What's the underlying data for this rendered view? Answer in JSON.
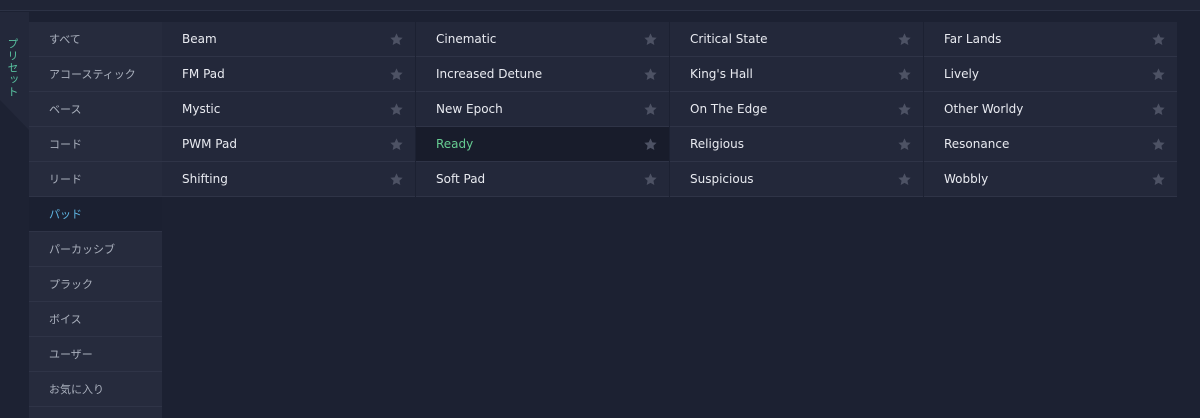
{
  "vertical_tab": {
    "label": "プリセット"
  },
  "sidebar": {
    "items": [
      {
        "label": "すべて",
        "active": false
      },
      {
        "label": "アコースティック",
        "active": false
      },
      {
        "label": "ベース",
        "active": false
      },
      {
        "label": "コード",
        "active": false
      },
      {
        "label": "リード",
        "active": false
      },
      {
        "label": "パッド",
        "active": true
      },
      {
        "label": "パーカッシブ",
        "active": false
      },
      {
        "label": "プラック",
        "active": false
      },
      {
        "label": "ボイス",
        "active": false
      },
      {
        "label": "ユーザー",
        "active": false
      },
      {
        "label": "お気に入り",
        "active": false
      }
    ]
  },
  "presets": [
    {
      "name": "Beam",
      "selected": false
    },
    {
      "name": "Cinematic",
      "selected": false
    },
    {
      "name": "Critical State",
      "selected": false
    },
    {
      "name": "Far Lands",
      "selected": false
    },
    {
      "name": "FM Pad",
      "selected": false
    },
    {
      "name": "Increased Detune",
      "selected": false
    },
    {
      "name": "King's Hall",
      "selected": false
    },
    {
      "name": "Lively",
      "selected": false
    },
    {
      "name": "Mystic",
      "selected": false
    },
    {
      "name": "New Epoch",
      "selected": false
    },
    {
      "name": "On The Edge",
      "selected": false
    },
    {
      "name": "Other Worldy",
      "selected": false
    },
    {
      "name": "PWM Pad",
      "selected": false
    },
    {
      "name": "Ready",
      "selected": true
    },
    {
      "name": "Religious",
      "selected": false
    },
    {
      "name": "Resonance",
      "selected": false
    },
    {
      "name": "Shifting",
      "selected": false
    },
    {
      "name": "Soft Pad",
      "selected": false
    },
    {
      "name": "Suspicious",
      "selected": false
    },
    {
      "name": "Wobbly",
      "selected": false
    }
  ],
  "icons": {
    "favorite": "star-icon"
  },
  "colors": {
    "background": "#1c2132",
    "panel": "#23283a",
    "selected_text": "#66cc92",
    "active_sidebar_text": "#5fb6e4",
    "tab_label": "#58c2a0",
    "star": "#4d5264"
  }
}
